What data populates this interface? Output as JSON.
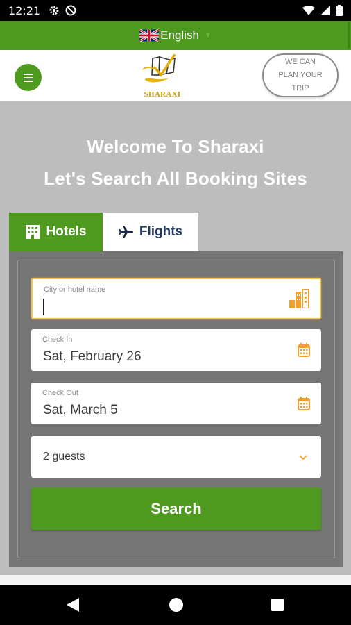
{
  "status_bar": {
    "time": "12:21"
  },
  "language": {
    "label": "English",
    "flag": "uk-flag-icon"
  },
  "header": {
    "logo_text": "SHARAXI",
    "plan_trip": {
      "line1": "WE CAN",
      "line2": "PLAN YOUR",
      "line3": "TRIP"
    }
  },
  "hero": {
    "line1": "Welcome To Sharaxi",
    "line2": "Let's Search All Booking Sites"
  },
  "tabs": [
    {
      "label": "Hotels",
      "icon": "hotel-icon",
      "active": true
    },
    {
      "label": "Flights",
      "icon": "airplane-icon",
      "active": false
    }
  ],
  "search_form": {
    "city": {
      "label": "City or hotel name",
      "value": "",
      "icon": "city-buildings-icon"
    },
    "check_in": {
      "label": "Check In",
      "value": "Sat, February 26",
      "icon": "calendar-icon"
    },
    "check_out": {
      "label": "Check Out",
      "value": "Sat, March 5",
      "icon": "calendar-icon"
    },
    "guests": {
      "value": "2 guests",
      "icon": "chevron-down-icon"
    },
    "submit_label": "Search"
  },
  "colors": {
    "brand_green": "#4e9a1f",
    "accent_orange": "#f0a030",
    "panel_gray": "#757575",
    "page_gray": "#bdbdbd"
  }
}
